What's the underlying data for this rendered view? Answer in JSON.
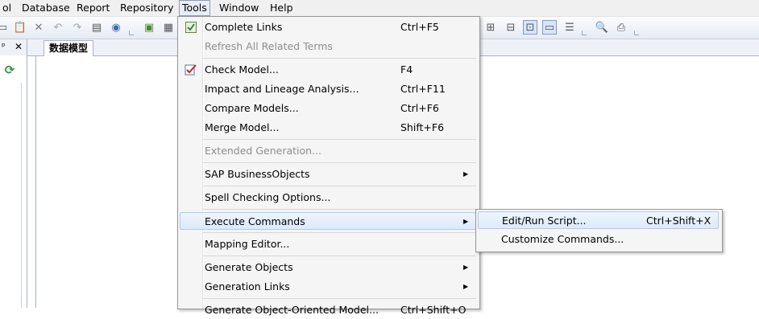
{
  "menubar": {
    "items": [
      "ol",
      "Database",
      "Report",
      "Repository",
      "Tools",
      "Window",
      "Help"
    ]
  },
  "panel": {
    "pin_glyph": "ᵖ",
    "close_glyph": "✕"
  },
  "tab": {
    "label": "数据模型"
  },
  "tools_menu": {
    "items": [
      {
        "label": "Complete Links",
        "shortcut": "Ctrl+F5",
        "icon": "complete-links-icon"
      },
      {
        "label": "Refresh All Related Terms",
        "shortcut": "",
        "disabled": true
      },
      {
        "label": "Check Model...",
        "shortcut": "F4",
        "icon": "check-model-icon"
      },
      {
        "label": "Impact and Lineage Analysis...",
        "shortcut": "Ctrl+F11"
      },
      {
        "label": "Compare Models...",
        "shortcut": "Ctrl+F6"
      },
      {
        "label": "Merge Model...",
        "shortcut": "Shift+F6"
      },
      {
        "label": "Extended Generation...",
        "shortcut": "",
        "disabled": true
      },
      {
        "label": "SAP BusinessObjects",
        "submenu": true
      },
      {
        "label": "Spell Checking Options...",
        "shortcut": ""
      },
      {
        "label": "Execute Commands",
        "submenu": true,
        "highlighted": true
      },
      {
        "label": "Mapping Editor...",
        "shortcut": ""
      },
      {
        "label": "Generate Objects",
        "submenu": true
      },
      {
        "label": "Generation Links",
        "submenu": true
      },
      {
        "label": "Generate Object-Oriented Model...",
        "shortcut": "Ctrl+Shift+O"
      }
    ]
  },
  "execute_commands_submenu": {
    "items": [
      {
        "label": "Edit/Run Script...",
        "shortcut": "Ctrl+Shift+X",
        "highlighted": true
      },
      {
        "label": "Customize Commands...",
        "shortcut": ""
      }
    ]
  },
  "colors": {
    "menu_background": "#f5f5f5",
    "highlight_border": "#aecbf0",
    "disabled_text": "#8d8d8d"
  }
}
